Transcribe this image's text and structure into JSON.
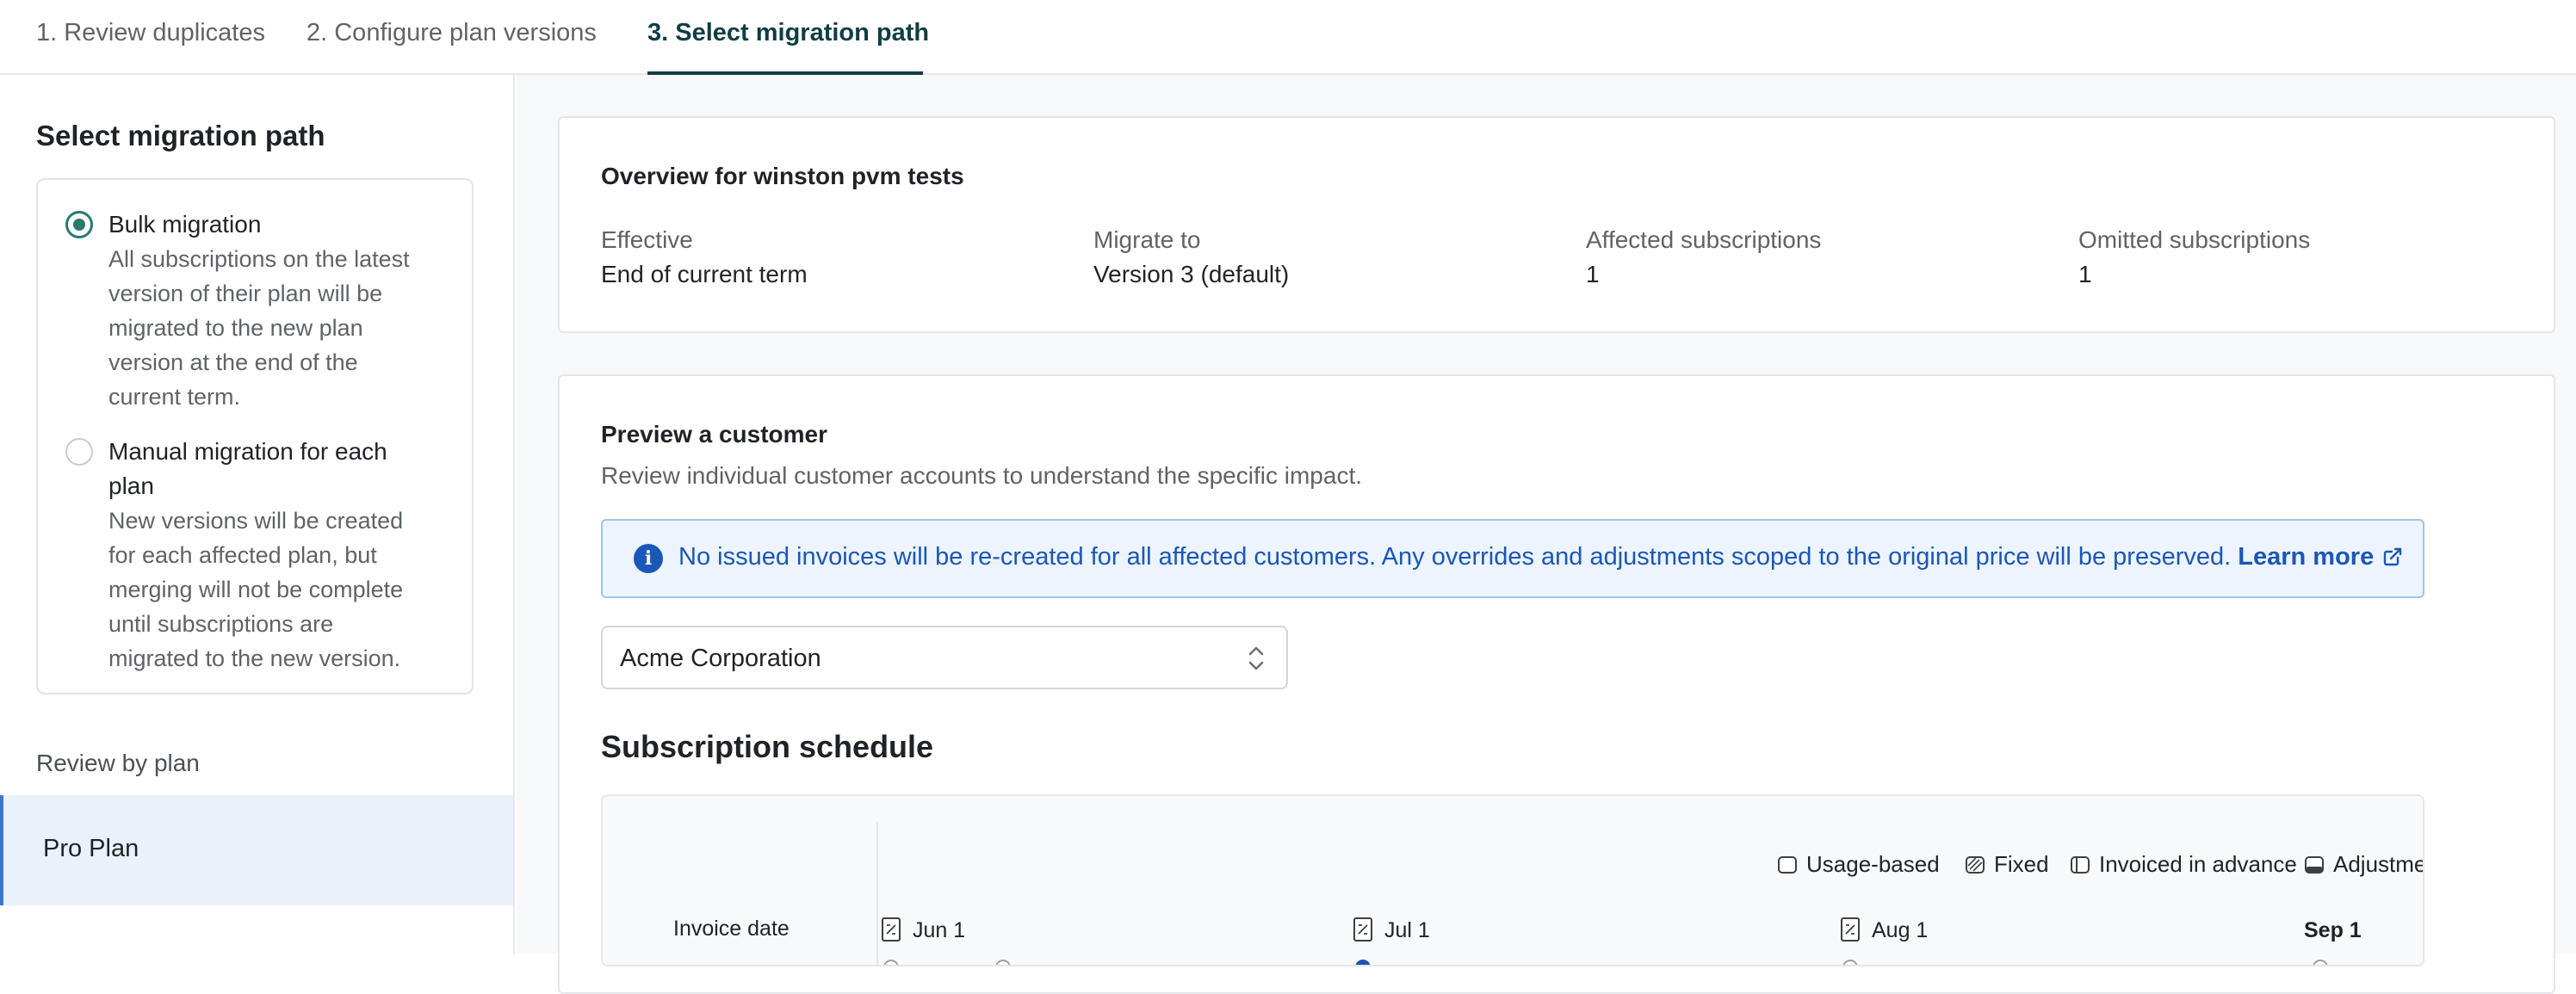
{
  "tabs": [
    {
      "label": "1. Review duplicates"
    },
    {
      "label": "2. Configure plan versions"
    },
    {
      "label": "3. Select migration path"
    }
  ],
  "sidebar": {
    "title": "Select migration path",
    "options": [
      {
        "title": "Bulk migration",
        "selected": true,
        "desc_lines": [
          "All subscriptions on the latest",
          "version of their plan will be",
          "migrated to the new plan",
          "version at the end of the",
          "current term."
        ]
      },
      {
        "title_lines": [
          "Manual migration for each",
          "plan"
        ],
        "selected": false,
        "desc_lines": [
          "New versions will be created",
          "for each affected plan, but",
          "merging will not be complete",
          "until subscriptions are",
          "migrated to the new version."
        ]
      }
    ],
    "review_label": "Review by plan",
    "plans": [
      {
        "label": "Pro Plan",
        "selected": true
      }
    ]
  },
  "overview": {
    "title": "Overview for winston pvm tests",
    "fields": [
      {
        "label": "Effective",
        "value": "End of current term"
      },
      {
        "label": "Migrate to",
        "value": "Version 3 (default)"
      },
      {
        "label": "Affected subscriptions",
        "value": "1"
      },
      {
        "label": "Omitted subscriptions",
        "value": "1"
      }
    ]
  },
  "preview": {
    "title": "Preview a customer",
    "subtitle": "Review individual customer accounts to understand the specific impact.",
    "banner_text": "No issued invoices will be re-created for all affected customers. Any overrides and adjustments scoped to the original price will be preserved.",
    "banner_link": "Learn more",
    "customer_select": "Acme Corporation"
  },
  "schedule": {
    "title": "Subscription schedule",
    "legend": [
      {
        "label": "Usage-based",
        "icon": "usage-based-icon"
      },
      {
        "label": "Fixed",
        "icon": "fixed-icon"
      },
      {
        "label": "Invoiced in advance",
        "icon": "invoiced-in-advance-icon"
      },
      {
        "label": "Adjustment",
        "icon": "adjustment-icon"
      }
    ],
    "row_label": "Invoice date",
    "dates": [
      "Jun 1",
      "Jul 1",
      "Aug 1",
      "Sep 1"
    ]
  },
  "colors": {
    "accent": "#0e3d45",
    "radio": "#2b7a6e",
    "info": "#1a57b8",
    "selected_bg": "#e9f1fb"
  }
}
